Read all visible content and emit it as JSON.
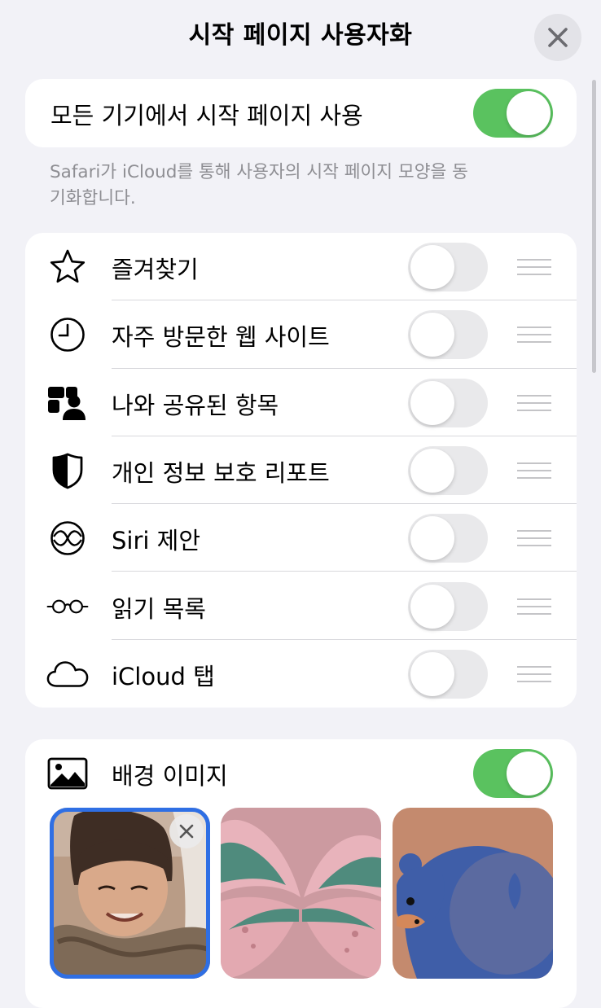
{
  "header": {
    "title": "시작 페이지 사용자화",
    "close_icon": "close-icon"
  },
  "sync": {
    "label": "모든 기기에서 시작 페이지 사용",
    "enabled": true,
    "footnote": "Safari가 iCloud를 통해 사용자의 시작 페이지 모양을 동기화합니다."
  },
  "sections": [
    {
      "label": "즐겨찾기",
      "icon": "star-icon",
      "enabled": false
    },
    {
      "label": "자주 방문한 웹 사이트",
      "icon": "clock-icon",
      "enabled": false
    },
    {
      "label": "나와 공유된 항목",
      "icon": "shared-people-icon",
      "enabled": false
    },
    {
      "label": "개인 정보 보호 리포트",
      "icon": "shield-icon",
      "enabled": false
    },
    {
      "label": "Siri 제안",
      "icon": "siri-icon",
      "enabled": false
    },
    {
      "label": "읽기 목록",
      "icon": "glasses-icon",
      "enabled": false
    },
    {
      "label": "iCloud 탭",
      "icon": "cloud-icon",
      "enabled": false
    }
  ],
  "background": {
    "label": "배경 이미지",
    "icon": "photo-icon",
    "enabled": true,
    "thumbnails": [
      {
        "name": "custom-photo",
        "selected": true
      },
      {
        "name": "butterfly",
        "selected": false
      },
      {
        "name": "bear",
        "selected": false
      }
    ]
  },
  "colors": {
    "toggle_on": "#5ac25f",
    "toggle_off": "#e9e9eb",
    "selection": "#2f6fe4"
  }
}
